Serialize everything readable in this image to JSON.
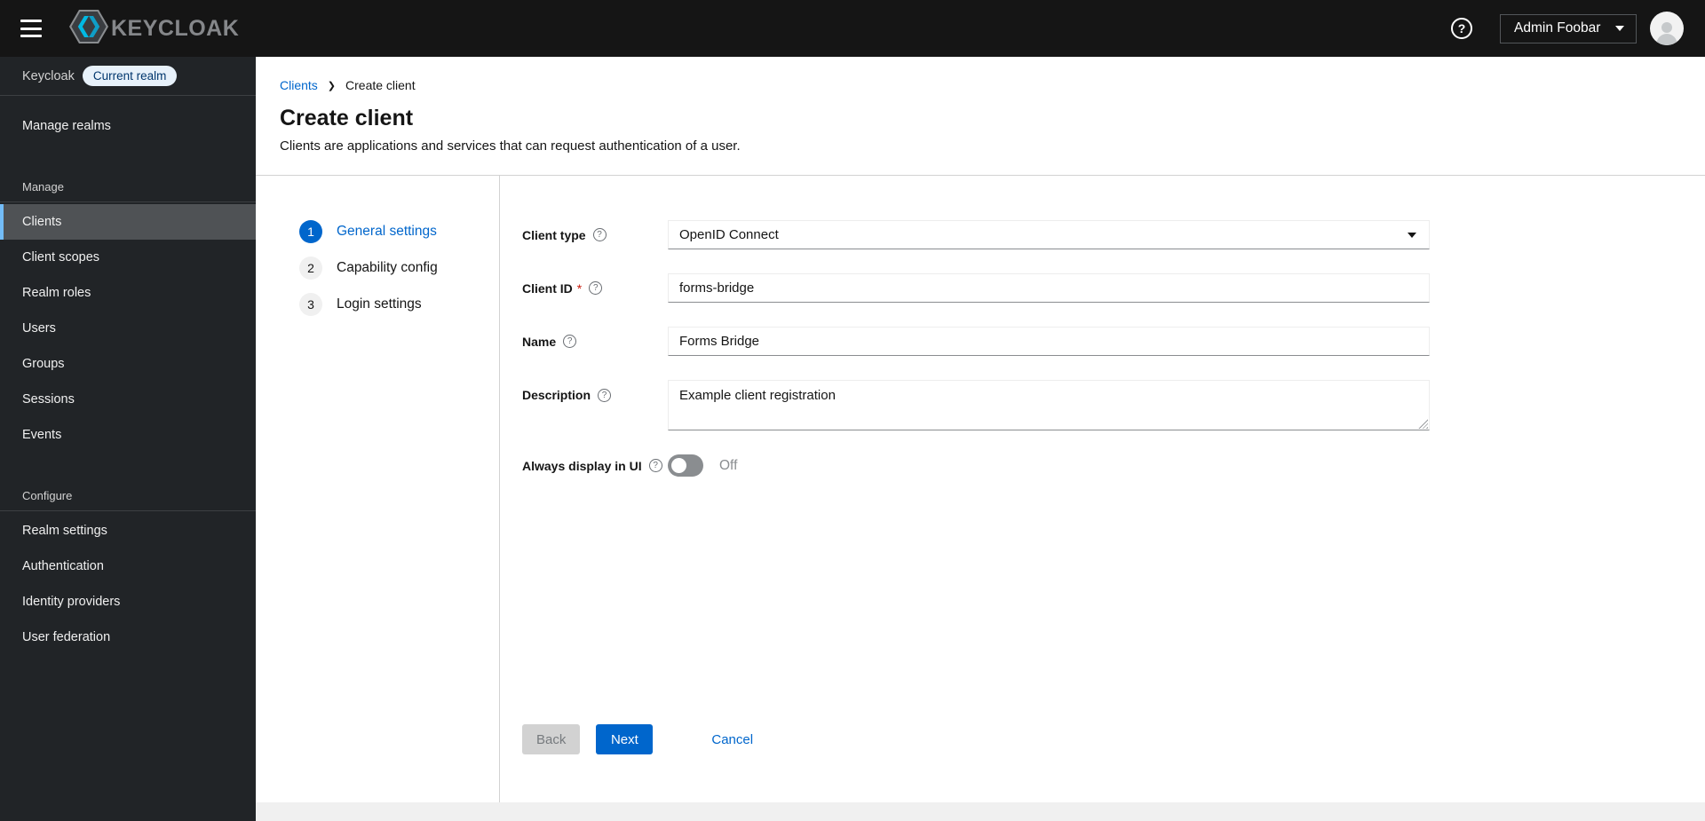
{
  "masthead": {
    "brand": "KEYCLOAK",
    "user_name": "Admin Foobar"
  },
  "sidebar": {
    "realm_label": "Keycloak",
    "realm_badge": "Current realm",
    "manage_realms": "Manage realms",
    "sections": [
      {
        "heading": "Manage",
        "items": [
          {
            "label": "Clients",
            "selected": true
          },
          {
            "label": "Client scopes"
          },
          {
            "label": "Realm roles"
          },
          {
            "label": "Users"
          },
          {
            "label": "Groups"
          },
          {
            "label": "Sessions"
          },
          {
            "label": "Events"
          }
        ]
      },
      {
        "heading": "Configure",
        "items": [
          {
            "label": "Realm settings"
          },
          {
            "label": "Authentication"
          },
          {
            "label": "Identity providers"
          },
          {
            "label": "User federation"
          }
        ]
      }
    ]
  },
  "breadcrumb": {
    "parent": "Clients",
    "current": "Create client"
  },
  "page": {
    "title": "Create client",
    "subtitle": "Clients are applications and services that can request authentication of a user."
  },
  "wizard_steps": [
    {
      "number": "1",
      "label": "General settings",
      "active": true
    },
    {
      "number": "2",
      "label": "Capability config",
      "active": false
    },
    {
      "number": "3",
      "label": "Login settings",
      "active": false
    }
  ],
  "form": {
    "client_type": {
      "label": "Client type",
      "value": "OpenID Connect"
    },
    "client_id": {
      "label": "Client ID",
      "required_marker": "*",
      "value": "forms-bridge"
    },
    "name": {
      "label": "Name",
      "value": "Forms Bridge"
    },
    "description": {
      "label": "Description",
      "value": "Example client registration"
    },
    "always_display": {
      "label": "Always display in UI",
      "state": "Off"
    }
  },
  "actions": {
    "back": "Back",
    "next": "Next",
    "cancel": "Cancel"
  },
  "icons": {
    "help": "?"
  },
  "colors": {
    "primary": "#0066cc",
    "masthead_bg": "#151515",
    "sidebar_bg": "#212427",
    "selected_nav_bg": "#4f5255",
    "selected_nav_border": "#73bcf7",
    "danger": "#c9190b",
    "page_bg": "#f0f0f0",
    "badge_bg": "#e7f1fa",
    "badge_text": "#00366d"
  }
}
